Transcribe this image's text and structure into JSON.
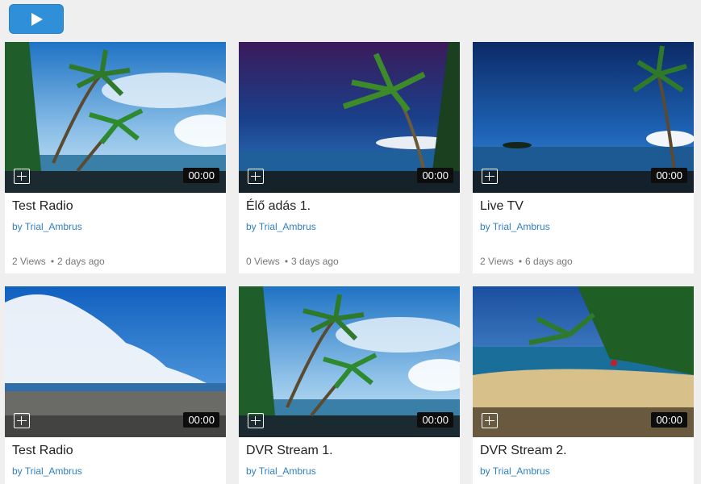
{
  "player": {
    "icon": "play-icon"
  },
  "colors": {
    "accent": "#2f8fd8",
    "link": "#2f7fc1",
    "duration_bg": "#0d0d0d"
  },
  "cards": [
    {
      "title": "Test Radio",
      "author": "by Trial_Ambrus",
      "duration": "00:00",
      "views": "2 Views",
      "age": "2 days ago",
      "thumbnail": "palm-beach-daylight"
    },
    {
      "title": "Élő adás 1.",
      "author": "by Trial_Ambrus",
      "duration": "00:00",
      "views": "0 Views",
      "age": "3 days ago",
      "thumbnail": "palm-beach-dusk"
    },
    {
      "title": "Live TV",
      "author": "by Trial_Ambrus",
      "duration": "00:00",
      "views": "2 Views",
      "age": "6 days ago",
      "thumbnail": "palm-island-sea"
    },
    {
      "title": "Test Radio",
      "author": "by Trial_Ambrus",
      "duration": "00:00",
      "views": "",
      "age": "",
      "thumbnail": "clouds-beach"
    },
    {
      "title": "DVR Stream 1.",
      "author": "by Trial_Ambrus",
      "duration": "00:00",
      "views": "",
      "age": "",
      "thumbnail": "palm-beach-daylight"
    },
    {
      "title": "DVR Stream 2.",
      "author": "by Trial_Ambrus",
      "duration": "00:00",
      "views": "",
      "age": "",
      "thumbnail": "tropical-sand-beach"
    }
  ]
}
